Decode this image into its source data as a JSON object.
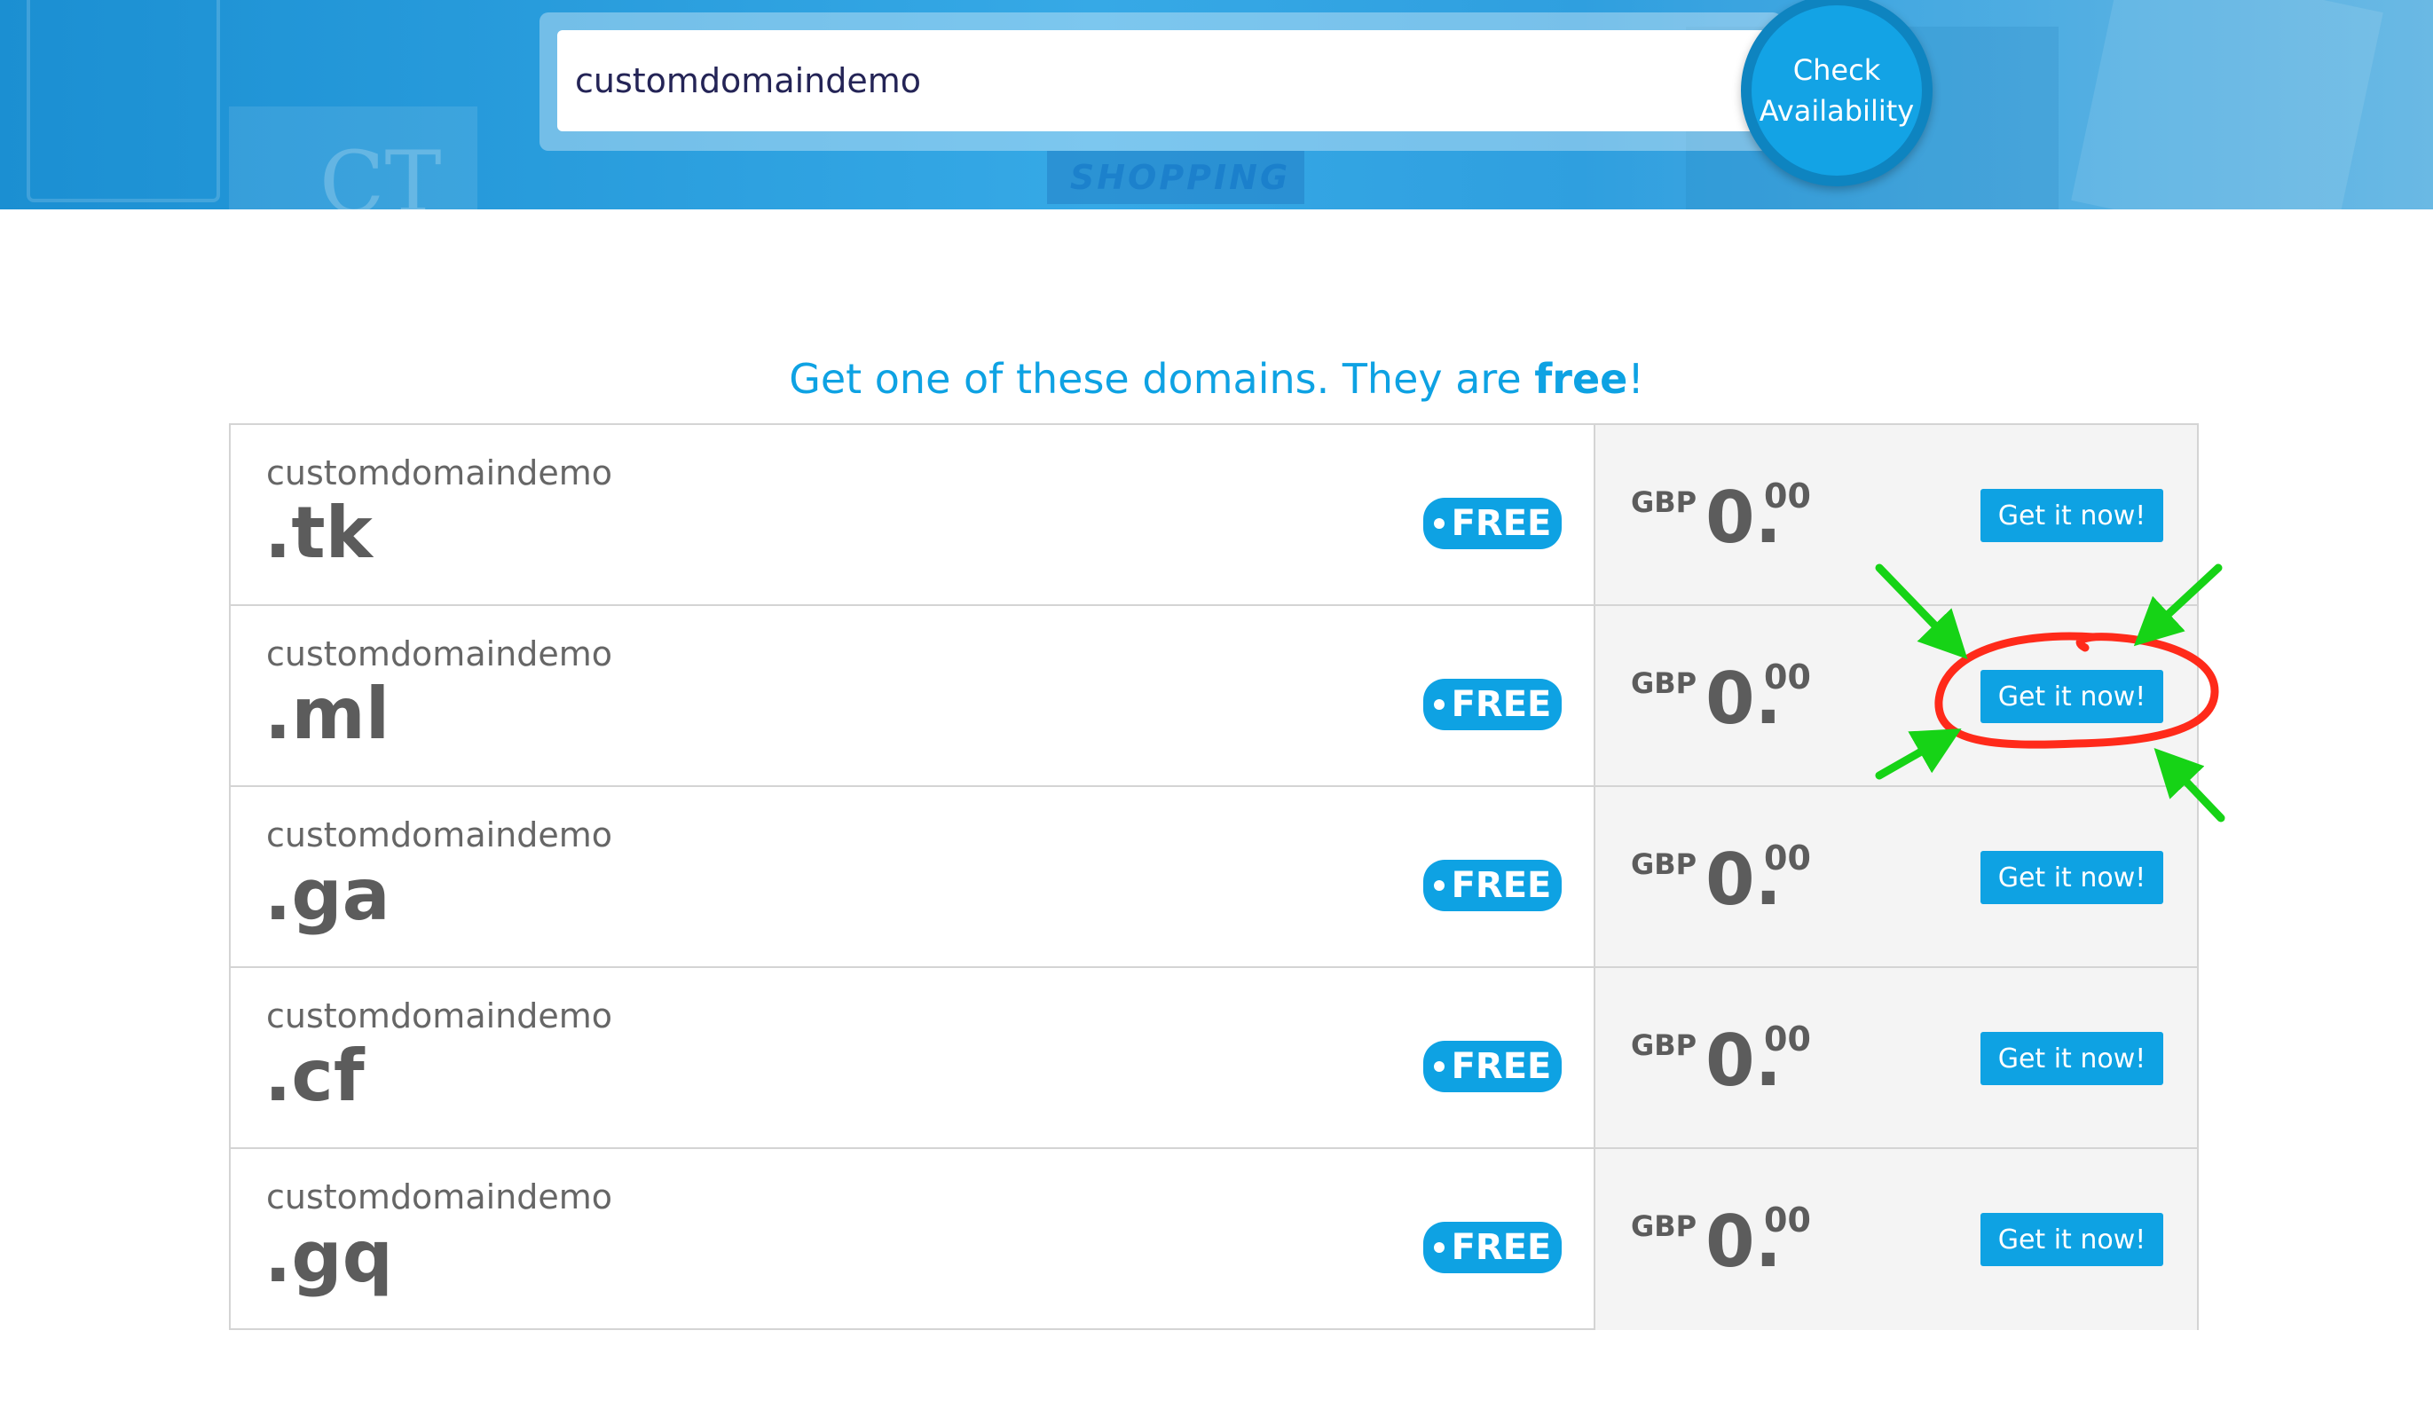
{
  "search": {
    "value": "customdomaindemo"
  },
  "check_button": {
    "line1": "Check",
    "line2": "Availability"
  },
  "hero": {
    "background_text": "SHOPPING",
    "sign_text": "CT"
  },
  "heading": {
    "prefix": "Get one of these domains. They are ",
    "emphasis": "free",
    "suffix": "!"
  },
  "domains": [
    {
      "name": "customdomaindemo",
      "tld": ".tk",
      "badge": "FREE",
      "currency": "GBP",
      "price_int": "0.",
      "price_dec": "00",
      "button": "Get it now!"
    },
    {
      "name": "customdomaindemo",
      "tld": ".ml",
      "badge": "FREE",
      "currency": "GBP",
      "price_int": "0.",
      "price_dec": "00",
      "button": "Get it now!"
    },
    {
      "name": "customdomaindemo",
      "tld": ".ga",
      "badge": "FREE",
      "currency": "GBP",
      "price_int": "0.",
      "price_dec": "00",
      "button": "Get it now!"
    },
    {
      "name": "customdomaindemo",
      "tld": ".cf",
      "badge": "FREE",
      "currency": "GBP",
      "price_int": "0.",
      "price_dec": "00",
      "button": "Get it now!"
    },
    {
      "name": "customdomaindemo",
      "tld": ".gq",
      "badge": "FREE",
      "currency": "GBP",
      "price_int": "0.",
      "price_dec": "00",
      "button": "Get it now!"
    }
  ],
  "colors": {
    "accent": "#0ea2e3",
    "annotation_circle": "#ff2a1a",
    "annotation_arrows": "#16d316"
  }
}
